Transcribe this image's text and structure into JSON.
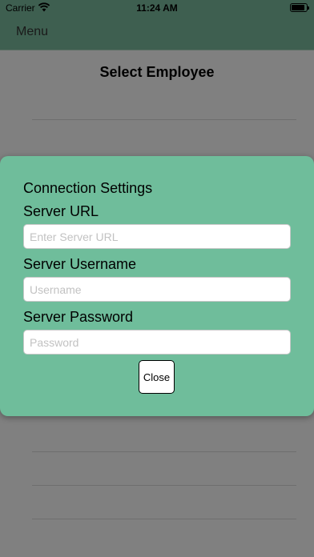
{
  "status_bar": {
    "carrier": "Carrier",
    "time": "11:24 AM",
    "wifi_icon": "wifi-icon",
    "battery_icon": "battery-icon"
  },
  "nav": {
    "menu_label": "Menu"
  },
  "page": {
    "title": "Select Employee"
  },
  "modal": {
    "title": "Connection Settings",
    "server_url": {
      "label": "Server URL",
      "placeholder": "Enter Server URL",
      "value": ""
    },
    "server_username": {
      "label": "Server Username",
      "placeholder": "Username",
      "value": ""
    },
    "server_password": {
      "label": "Server Password",
      "placeholder": "Password",
      "value": ""
    },
    "close_label": "Close"
  },
  "colors": {
    "nav_background": "#3e5f50",
    "overlay_background": "#808080",
    "modal_background": "#6fbd9b"
  }
}
